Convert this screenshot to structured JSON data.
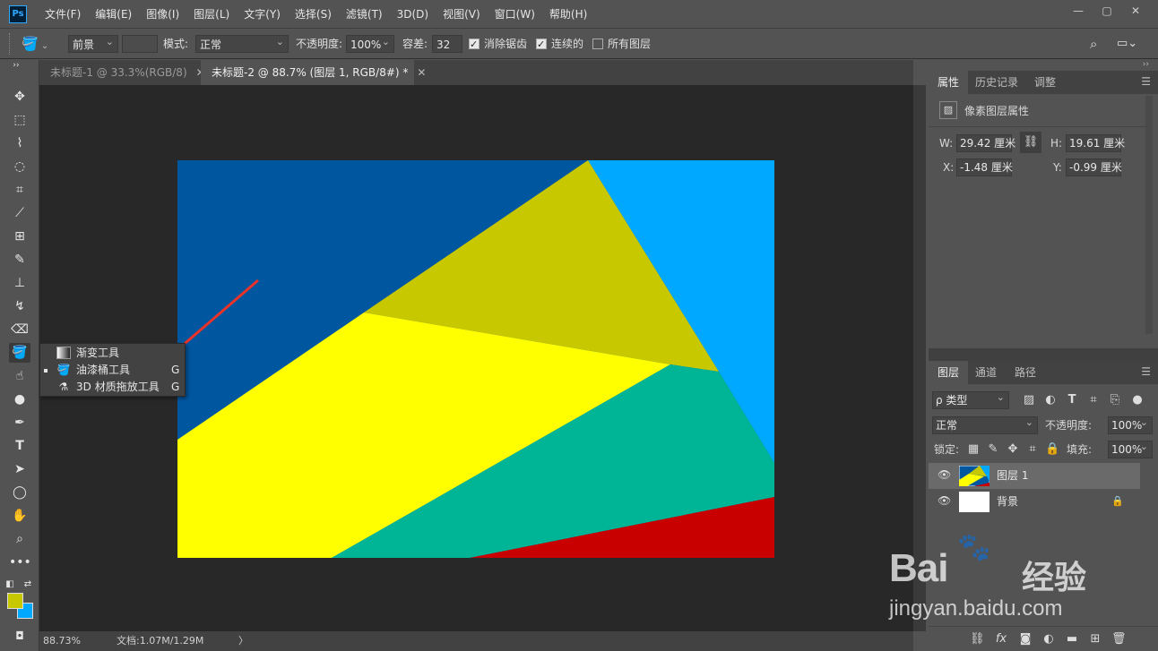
{
  "app": {
    "logo_text": "Ps"
  },
  "menu": [
    "文件(F)",
    "编辑(E)",
    "图像(I)",
    "图层(L)",
    "文字(Y)",
    "选择(S)",
    "滤镜(T)",
    "3D(D)",
    "视图(V)",
    "窗口(W)",
    "帮助(H)"
  ],
  "window": {
    "minimize": "—",
    "maximize": "▢",
    "close": "✕"
  },
  "options": {
    "fill_source": "前景",
    "mode_label": "模式:",
    "mode_value": "正常",
    "opacity_label": "不透明度:",
    "opacity_value": "100%",
    "tolerance_label": "容差:",
    "tolerance_value": "32",
    "antialias_label": "消除锯齿",
    "contiguous_label": "连续的",
    "all_layers_label": "所有图层"
  },
  "doc_tabs": [
    {
      "label": "未标题-1 @ 33.3%(RGB/8)",
      "active": false
    },
    {
      "label": "未标题-2 @ 88.7% (图层 1, RGB/8#) *",
      "active": true
    }
  ],
  "flyout": [
    {
      "label": "渐变工具",
      "key": "G",
      "icon": "gradient-icon",
      "selected": false
    },
    {
      "label": "油漆桶工具",
      "key": "G",
      "icon": "paint-bucket-icon",
      "selected": true
    },
    {
      "label": "3D 材质拖放工具",
      "key": "G",
      "icon": "3d-material-drop-icon",
      "selected": false
    }
  ],
  "status": {
    "zoom": "88.73%",
    "doc_info": "文档:1.07M/1.29M",
    "arrow": "〉"
  },
  "properties_panel": {
    "tabs": [
      "属性",
      "历史记录",
      "调整"
    ],
    "title": "像素图层属性",
    "w_label": "W:",
    "w_value": "29.42 厘米",
    "h_label": "H:",
    "h_value": "19.61 厘米",
    "x_label": "X:",
    "x_value": "-1.48 厘米",
    "y_label": "Y:",
    "y_value": "-0.99 厘米"
  },
  "layers_panel": {
    "tabs": [
      "图层",
      "通道",
      "路径"
    ],
    "filter_label": "ρ 类型",
    "blend_mode": "正常",
    "opacity_label": "不透明度:",
    "opacity_value": "100%",
    "lock_label": "锁定:",
    "fill_label": "填充:",
    "fill_value": "100%",
    "layers": [
      {
        "name": "图层 1",
        "selected": true,
        "locked": false
      },
      {
        "name": "背景",
        "selected": false,
        "locked": true
      }
    ]
  },
  "watermark": {
    "brand": "Bai",
    "brand_cn": "经验",
    "url": "jingyan.baidu.com"
  },
  "colors": {
    "foreground": "#c8c800",
    "background": "#00a8ff",
    "art_dark_blue": "#0057a0",
    "art_olive": "#c8c800",
    "art_light_blue": "#00a8ff",
    "art_yellow": "#ffff00",
    "art_teal": "#00b496",
    "art_red": "#c80000",
    "annotation_arrow": "#e8322a"
  }
}
